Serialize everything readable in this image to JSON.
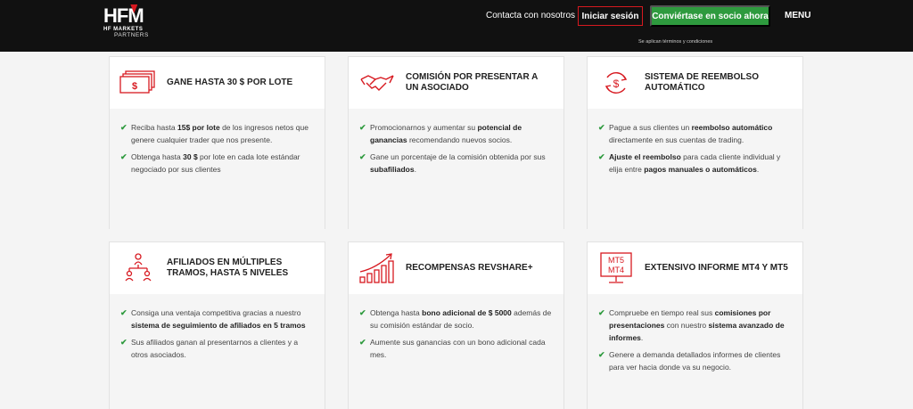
{
  "header": {
    "logo_mark_hf": "HF",
    "logo_mark_m": "M",
    "logo_sub": "HF MARKETS",
    "logo_sub2": "PARTNERS",
    "contact": "Contacta con nosotros",
    "login": "Iniciar sesión",
    "partner": "Conviértase en socio ahora",
    "menu": "MENU",
    "terms": "Se aplican términos y condiciones"
  },
  "colors": {
    "brand_red": "#d71920",
    "brand_green": "#2e9a3e"
  },
  "cards": [
    {
      "icon": "money-icon",
      "title": "GANE HASTA 30 $ POR LOTE",
      "items": [
        [
          "Reciba hasta ",
          "15$ por lote",
          " de los ingresos netos que genere cualquier trader que nos presente."
        ],
        [
          "Obtenga hasta ",
          "30 $",
          " por lote en cada lote estándar negociado por sus clientes"
        ]
      ]
    },
    {
      "icon": "handshake-icon",
      "title": "COMISIÓN POR PRESENTAR A UN ASOCIADO",
      "items": [
        [
          "Promocionarnos y aumentar su ",
          "potencial de ganancias",
          " recomendando nuevos socios."
        ],
        [
          "Gane un porcentaje de la comisión obtenida por sus ",
          "subafiliados",
          "."
        ]
      ]
    },
    {
      "icon": "refund-icon",
      "title": "SISTEMA DE REEMBOLSO AUTOMÁTICO",
      "items": [
        [
          "Pague a sus clientes un ",
          "reembolso automático",
          " directamente en sus cuentas de trading."
        ],
        [
          "",
          "Ajuste el reembolso",
          " para cada cliente individual y elija entre pagos manuales o automáticos."
        ]
      ]
    },
    {
      "icon": "affiliate-tree-icon",
      "title": "AFILIADOS EN MÚLTIPLES TRAMOS, HASTA 5 NIVELES",
      "items": [
        [
          "Consiga una ventaja competitiva gracias a nuestro ",
          "sistema de seguimiento de afiliados en 5 tramos",
          ""
        ],
        [
          "Sus afiliados ganan al presentarnos a clientes y a otros asociados.",
          "",
          ""
        ]
      ]
    },
    {
      "icon": "growth-chart-icon",
      "title": "RECOMPENSAS REVSHARE+",
      "items": [
        [
          "Obtenga hasta ",
          "bono adicional de $ 5000",
          " además de su comisión estándar de socio."
        ],
        [
          "Aumente sus ganancias con un bono adicional cada mes.",
          "",
          ""
        ]
      ]
    },
    {
      "icon": "monitor-icon",
      "title": "EXTENSIVO INFORME MT4 Y MT5",
      "icon_text": [
        "MT5",
        "MT4"
      ],
      "items": [
        [
          "Compruebe en tiempo real sus ",
          "comisiones por presentaciones",
          " con nuestro sistema avanzado de informes."
        ],
        [
          "Genere a demanda detallados informes de clientes para ver hacia donde va su negocio.",
          "",
          ""
        ]
      ]
    }
  ],
  "card3_item2_bold2": "pagos manuales o automáticos",
  "card3_item2_mid": " para cada cliente individual y elija entre ",
  "card3_item2_end": ".",
  "card6_item1_bold2": "sistema avanzado de informes",
  "card6_item1_mid": " con nuestro ",
  "card6_item1_end": "."
}
